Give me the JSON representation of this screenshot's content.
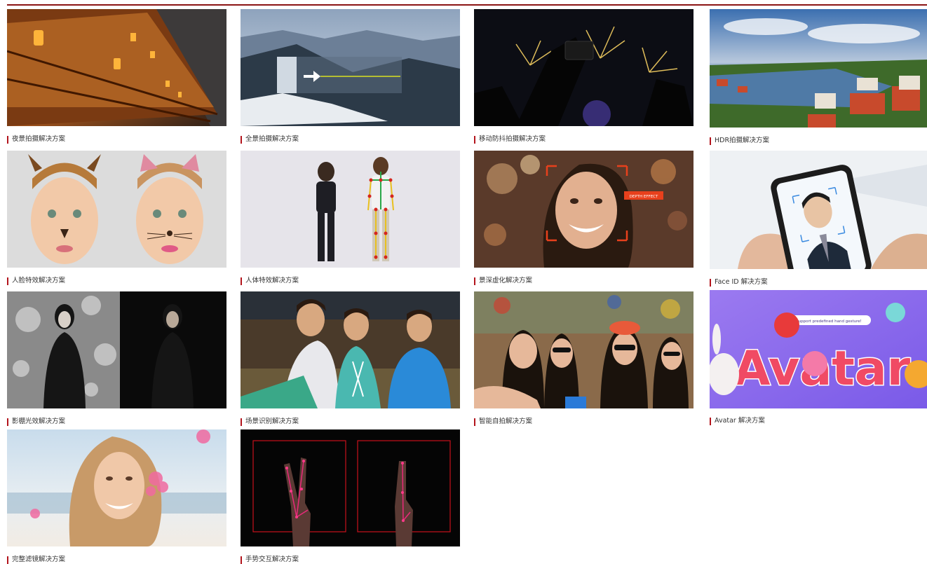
{
  "colors": {
    "accent": "#b3141c",
    "top_rule": "#8b1414",
    "caption_text": "#333333"
  },
  "solutions": [
    {
      "label": "夜景拍摄解决方案",
      "image": "night-architecture-lanterns"
    },
    {
      "label": "全景拍摄解决方案",
      "image": "snowy-mountain-panorama"
    },
    {
      "label": "移动防抖拍摄解决方案",
      "image": "fireworks-phone-recording"
    },
    {
      "label": "HDR拍摄解决方案",
      "image": "coastal-town-hdr"
    },
    {
      "label": "人脸特效解决方案",
      "image": "face-deer-cat-effects"
    },
    {
      "label": "人体特效解决方案",
      "image": "body-skeleton-keypoints"
    },
    {
      "label": "景深虚化解决方案",
      "image": "portrait-depth-effect",
      "overlay_text": "DEPTH EFFECT"
    },
    {
      "label": "Face ID 解决方案",
      "image": "phone-face-id-scan"
    },
    {
      "label": "影棚光效解决方案",
      "image": "studio-lighting-portrait"
    },
    {
      "label": "场景识别解决方案",
      "image": "friends-scene-recognition"
    },
    {
      "label": "智能自拍解决方案",
      "image": "group-selfie"
    },
    {
      "label": "Avatar 解决方案",
      "image": "avatar-3d-characters",
      "overlay_text": "Avatar",
      "speech_text": "Support predefined hand gesture!"
    },
    {
      "label": "完整滤镜解决方案",
      "image": "beach-filter-portrait"
    },
    {
      "label": "手势交互解决方案",
      "image": "hand-gesture-tracking"
    }
  ]
}
